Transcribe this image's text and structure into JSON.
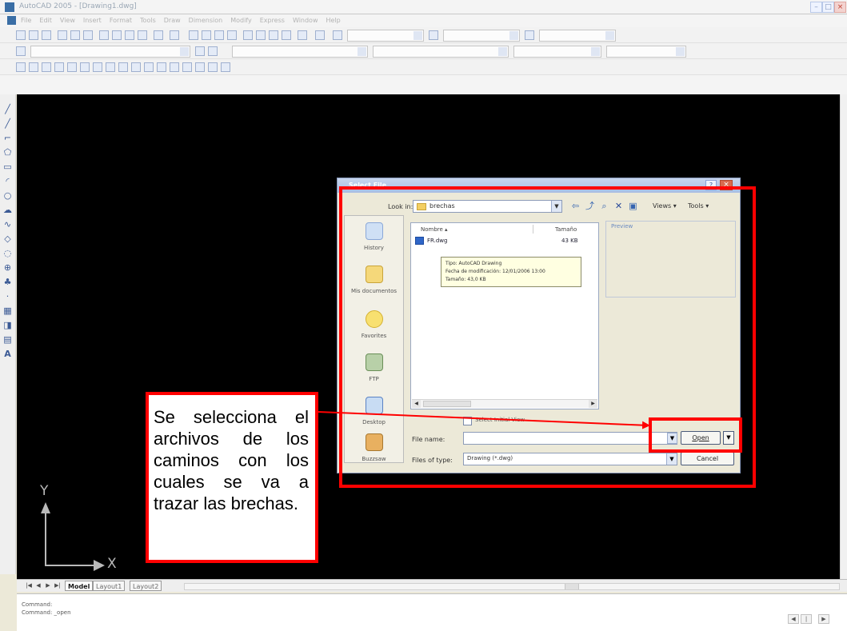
{
  "window": {
    "title": "AutoCAD 2005 - [Drawing1.dwg]"
  },
  "menubar": {
    "items": [
      "File",
      "Edit",
      "View",
      "Insert",
      "Format",
      "Tools",
      "Draw",
      "Dimension",
      "Modify",
      "Express",
      "Window",
      "Help"
    ]
  },
  "ucs": {
    "x_label": "X",
    "y_label": "Y"
  },
  "layout_tabs": {
    "model": "Model",
    "layout1": "Layout1",
    "layout2": "Layout2"
  },
  "command_line": {
    "line1": "Command:",
    "line2": "Command:  _open"
  },
  "dialog": {
    "title": "Select File",
    "look_in_label": "Look in:",
    "look_in_value": "brechas",
    "views_label": "Views",
    "tools_label": "Tools",
    "places": [
      "History",
      "Mis documentos",
      "Favorites",
      "FTP",
      "Desktop",
      "Buzzsaw"
    ],
    "column_name": "Nombre",
    "column_size": "Tamaño",
    "file": {
      "name": "FR.dwg",
      "size": "43 KB"
    },
    "tooltip": {
      "line1": "Tipo: AutoCAD Drawing",
      "line2": "Fecha de modificación: 12/01/2006 13:00",
      "line3": "Tamaño: 43,0 KB"
    },
    "preview_label": "Preview",
    "checkbox_label": "Select Initial View",
    "file_name_label": "File name:",
    "file_name_value": "",
    "files_of_type_label": "Files of type:",
    "files_of_type_value": "Drawing (*.dwg)",
    "open_label": "Open",
    "cancel_label": "Cancel"
  },
  "annotation": {
    "note": "Se selecciona el archivos de los caminos con los cuales se va a trazar las brechas.",
    "color": "#ff0000"
  }
}
